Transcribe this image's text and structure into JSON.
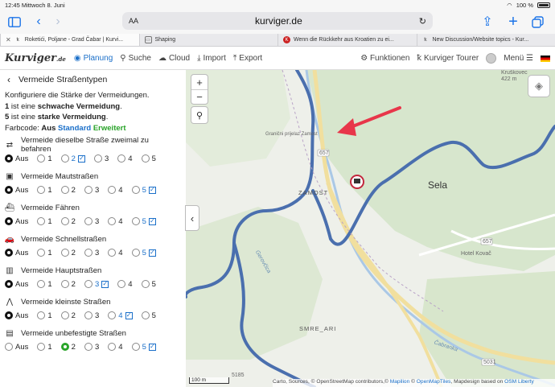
{
  "status": {
    "time": "12:45",
    "date": "Mittwoch 8. Juni",
    "battery": "100 %"
  },
  "browser": {
    "font_size_label": "AA",
    "url": "kurviger.de",
    "tabs": [
      {
        "title": "Roketići, Poljane - Grad Čabar | Kurvi...",
        "active": true
      },
      {
        "title": "Shaping",
        "active": false
      },
      {
        "title": "Wenn die Rückkehr aus Kroatien zu ei...",
        "active": false
      },
      {
        "title": "New Discussion/Website topics - Kur...",
        "active": false
      }
    ]
  },
  "app": {
    "logo": "Kurviger",
    "logo_suffix": ".de",
    "nav": [
      {
        "label": "Planung",
        "icon": "map-pin-icon",
        "active": true
      },
      {
        "label": "Suche",
        "icon": "search-icon",
        "active": false
      },
      {
        "label": "Cloud",
        "icon": "cloud-icon",
        "active": false
      },
      {
        "label": "Import",
        "icon": "import-icon",
        "active": false
      },
      {
        "label": "Export",
        "icon": "export-icon",
        "active": false
      }
    ],
    "right": {
      "features": "Funktionen",
      "tourer": "Kurviger Tourer",
      "menu": "Menü"
    }
  },
  "sidebar": {
    "title": "Vermeide Straßentypen",
    "intro_line1": "Konfiguriere die Stärke der Vermeidungen.",
    "intro_line2_num": "1",
    "intro_line2_mid": " ist eine ",
    "intro_line2_bold": "schwache Vermeidung",
    "intro_line2_end": ".",
    "intro_line3_num": "5",
    "intro_line3_mid": " ist eine ",
    "intro_line3_bold": "starke Vermeidung",
    "intro_line3_end": ".",
    "color_code_label": "Farbcode: ",
    "color_aus": "Aus",
    "color_standard": "Standard",
    "color_extended": "Erweitert",
    "options": [
      {
        "title": "Vermeide dieselbe Straße zweimal zu befahren",
        "icon": "shuffle-icon",
        "selected": "Aus",
        "checked": "2"
      },
      {
        "title": "Vermeide Mautstraßen",
        "icon": "toll-icon",
        "selected": "Aus",
        "checked": "5"
      },
      {
        "title": "Vermeide Fähren",
        "icon": "ferry-icon",
        "selected": "Aus",
        "checked": "5"
      },
      {
        "title": "Vermeide Schnellstraßen",
        "icon": "car-icon",
        "selected": "Aus",
        "checked": "5"
      },
      {
        "title": "Vermeide Hauptstraßen",
        "icon": "road-icon",
        "selected": "Aus",
        "checked": "3"
      },
      {
        "title": "Vermeide kleinste Straßen",
        "icon": "narrow-road-icon",
        "selected": "Aus",
        "checked": "4"
      },
      {
        "title": "Vermeide unbefestigte Straßen",
        "icon": "gravel-icon",
        "selected": "2",
        "checked": "5"
      }
    ],
    "choices": [
      "Aus",
      "1",
      "2",
      "3",
      "4",
      "5"
    ]
  },
  "map": {
    "labels": {
      "town": "Sela",
      "zamost": "ZAMOST",
      "smrecari": "SMRE_ARI",
      "granicni": "Granični prijelaz Zamost",
      "hotel": "Hotel Kovač",
      "river1": "Gerovčica",
      "river2": "Čabranka",
      "peak": "Kruškovec",
      "peak_ele": "422 m",
      "road657a": "657",
      "road657b": "657",
      "road5031": "5031",
      "road5185": "5185"
    },
    "scale": "100 m",
    "attribution_a": "Carto, Sources, © OpenStreetMap",
    "attribution_b": " contributors,© ",
    "attribution_c": "Mapilion",
    "attribution_d": " © ",
    "attribution_e": "OpenMapTiles",
    "attribution_f": ", Mapdesign based on ",
    "attribution_g": "OSM Liberty",
    "colors": {
      "route": "#4a6fae",
      "accent": "#1a6fc9",
      "arrow": "#e8364a"
    }
  }
}
